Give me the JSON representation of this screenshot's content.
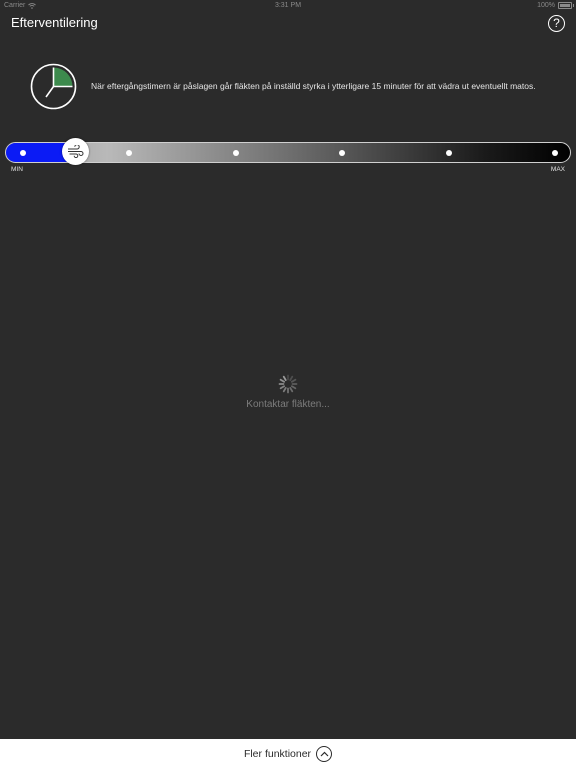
{
  "status_bar": {
    "carrier": "Carrier",
    "time": "3:31 PM",
    "battery": "100%"
  },
  "header": {
    "title": "Efterventilering",
    "help_label": "?"
  },
  "timer": {
    "icon": "timer-clock-icon",
    "description": "När eftergångstimern är påslagen går fläkten på inställd styrka i ytterligare 15 minuter för att vädra ut eventuellt matos."
  },
  "fan_slider": {
    "min_label": "MIN",
    "max_label": "MAX",
    "steps": 6,
    "selected_step": 1,
    "thumb_icon": "wind-icon",
    "fill_color": "#0b1bf5"
  },
  "loading": {
    "text": "Kontaktar fläkten..."
  },
  "bottom_bar": {
    "label": "Fler funktioner",
    "icon": "chevron-up-circle-icon"
  }
}
